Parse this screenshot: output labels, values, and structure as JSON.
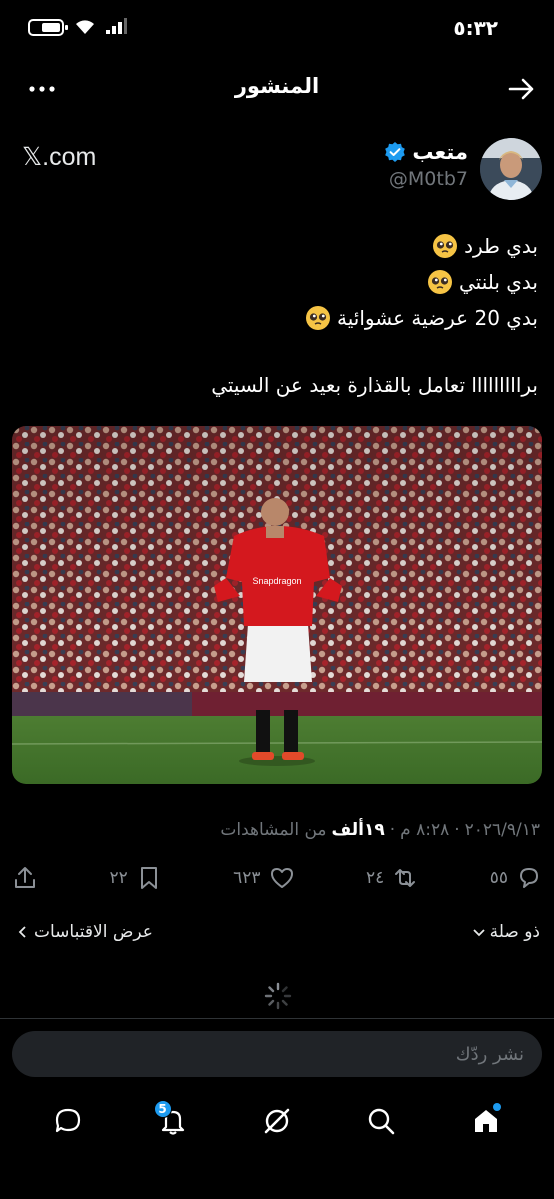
{
  "status": {
    "time": "٥:٣٢"
  },
  "topbar": {
    "title": "المنشور"
  },
  "author": {
    "name": "متعب",
    "handle": "@M0tb7",
    "site": "𝕏.com"
  },
  "tweet": {
    "lines": [
      "بدي طرد",
      "بدي بلنتي",
      "بدي 20 عرضية عشوائية"
    ],
    "final_line": "برااااااااا تعامل بالقذارة بعيد عن السيتي"
  },
  "meta": {
    "time": "٨:٢٨ م",
    "date": "٢٠٢٦/٩/١٣",
    "views_count": "١٩ألف",
    "views_label": "من المشاهدات"
  },
  "actions": {
    "replies": "٥٥",
    "reposts": "٢٤",
    "likes": "٦٢٣",
    "bookmarks": "٢٢"
  },
  "links": {
    "related": "ذو صلة",
    "quotes": "عرض الاقتباسات"
  },
  "reply": {
    "placeholder": "نشر ردّك"
  },
  "nav": {
    "notifications_badge": "5"
  },
  "colors": {
    "accent": "#1d9bf0",
    "background": "#000000",
    "muted": "#71767b"
  },
  "icons": [
    "back-arrow-icon",
    "more-icon",
    "verified-icon",
    "reply-icon",
    "repost-icon",
    "like-icon",
    "bookmark-icon",
    "share-icon",
    "home-icon",
    "search-icon",
    "grok-icon",
    "notifications-icon",
    "messages-icon"
  ]
}
